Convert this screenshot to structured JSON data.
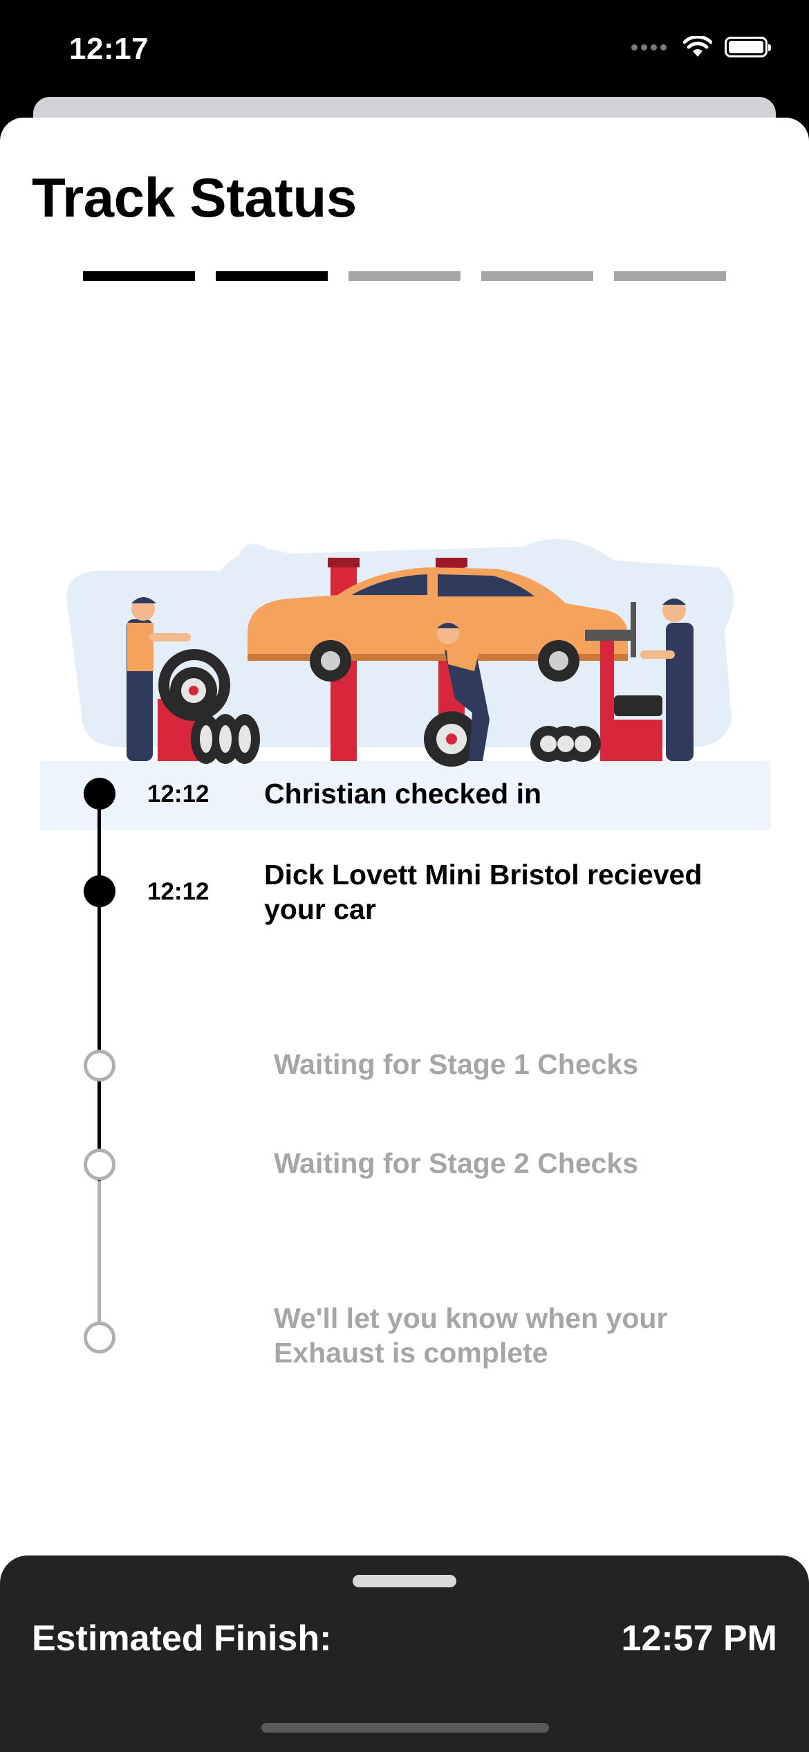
{
  "status_bar": {
    "time": "12:17"
  },
  "page": {
    "title": "Track Status"
  },
  "progress": {
    "total_steps": 5,
    "completed_steps": 2
  },
  "timeline": [
    {
      "time": "12:12",
      "label": "Christian checked in",
      "state": "done"
    },
    {
      "time": "12:12",
      "label": "Dick Lovett Mini Bristol recieved your car",
      "state": "done"
    },
    {
      "time": "",
      "label": "Waiting for Stage 1 Checks",
      "state": "pending"
    },
    {
      "time": "",
      "label": "Waiting for Stage 2 Checks",
      "state": "pending"
    },
    {
      "time": "",
      "label": "We'll let you know when your Exhaust is complete",
      "state": "pending"
    }
  ],
  "footer": {
    "label": "Estimated Finish:",
    "value": "12:57 PM"
  },
  "colors": {
    "done": "#000000",
    "pending": "#a6a6a6",
    "footer_bg": "#232323",
    "car": "#f5a25d",
    "lift": "#d8273a",
    "worker": "#2f3a5c"
  }
}
